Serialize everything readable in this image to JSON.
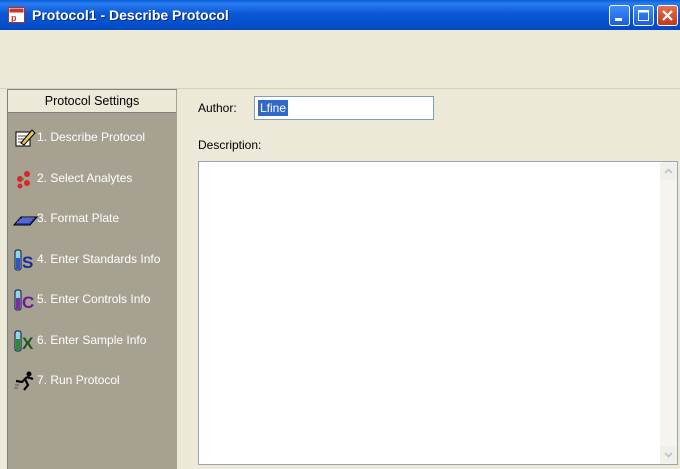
{
  "window": {
    "title": "Protocol1 - Describe Protocol",
    "icon": "app-icon"
  },
  "sidebar": {
    "header": "Protocol Settings",
    "items": [
      {
        "label": "1. Describe Protocol",
        "icon": "notepad-pencil-icon"
      },
      {
        "label": "2. Select Analytes",
        "icon": "analytes-dots-icon"
      },
      {
        "label": "3. Format Plate",
        "icon": "plate-icon"
      },
      {
        "label": "4. Enter Standards Info",
        "icon": "tube-s-icon"
      },
      {
        "label": "5. Enter Controls Info",
        "icon": "tube-c-icon"
      },
      {
        "label": "6. Enter Sample Info",
        "icon": "tube-x-icon"
      },
      {
        "label": "7. Run Protocol",
        "icon": "runner-icon"
      }
    ]
  },
  "form": {
    "author_label": "Author:",
    "author_value": "Lfine",
    "description_label": "Description:",
    "description_value": ""
  }
}
